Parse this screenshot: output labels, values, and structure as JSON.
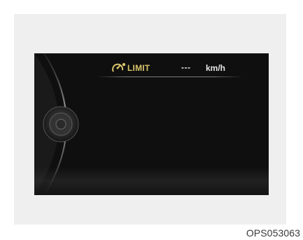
{
  "display": {
    "limit_label": "LIMIT",
    "speed_value": "---",
    "speed_unit": "km/h",
    "limit_icon": "speed-limiter-icon"
  },
  "figure": {
    "code": "OPS053063"
  },
  "colors": {
    "screen_background": "#0f0f0f",
    "limit_label": "#d8c46a",
    "speed_text": "#e6e6e6",
    "frame_background": "#efefef"
  }
}
